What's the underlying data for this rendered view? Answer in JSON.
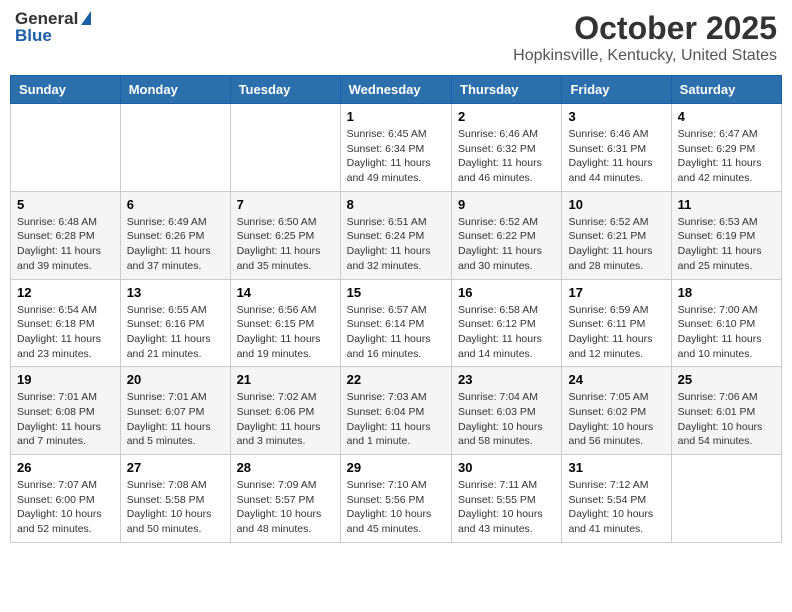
{
  "header": {
    "logo_general": "General",
    "logo_blue": "Blue",
    "month": "October 2025",
    "location": "Hopkinsville, Kentucky, United States"
  },
  "weekdays": [
    "Sunday",
    "Monday",
    "Tuesday",
    "Wednesday",
    "Thursday",
    "Friday",
    "Saturday"
  ],
  "weeks": [
    [
      {
        "day": "",
        "sunrise": "",
        "sunset": "",
        "daylight": ""
      },
      {
        "day": "",
        "sunrise": "",
        "sunset": "",
        "daylight": ""
      },
      {
        "day": "",
        "sunrise": "",
        "sunset": "",
        "daylight": ""
      },
      {
        "day": "1",
        "sunrise": "Sunrise: 6:45 AM",
        "sunset": "Sunset: 6:34 PM",
        "daylight": "Daylight: 11 hours and 49 minutes."
      },
      {
        "day": "2",
        "sunrise": "Sunrise: 6:46 AM",
        "sunset": "Sunset: 6:32 PM",
        "daylight": "Daylight: 11 hours and 46 minutes."
      },
      {
        "day": "3",
        "sunrise": "Sunrise: 6:46 AM",
        "sunset": "Sunset: 6:31 PM",
        "daylight": "Daylight: 11 hours and 44 minutes."
      },
      {
        "day": "4",
        "sunrise": "Sunrise: 6:47 AM",
        "sunset": "Sunset: 6:29 PM",
        "daylight": "Daylight: 11 hours and 42 minutes."
      }
    ],
    [
      {
        "day": "5",
        "sunrise": "Sunrise: 6:48 AM",
        "sunset": "Sunset: 6:28 PM",
        "daylight": "Daylight: 11 hours and 39 minutes."
      },
      {
        "day": "6",
        "sunrise": "Sunrise: 6:49 AM",
        "sunset": "Sunset: 6:26 PM",
        "daylight": "Daylight: 11 hours and 37 minutes."
      },
      {
        "day": "7",
        "sunrise": "Sunrise: 6:50 AM",
        "sunset": "Sunset: 6:25 PM",
        "daylight": "Daylight: 11 hours and 35 minutes."
      },
      {
        "day": "8",
        "sunrise": "Sunrise: 6:51 AM",
        "sunset": "Sunset: 6:24 PM",
        "daylight": "Daylight: 11 hours and 32 minutes."
      },
      {
        "day": "9",
        "sunrise": "Sunrise: 6:52 AM",
        "sunset": "Sunset: 6:22 PM",
        "daylight": "Daylight: 11 hours and 30 minutes."
      },
      {
        "day": "10",
        "sunrise": "Sunrise: 6:52 AM",
        "sunset": "Sunset: 6:21 PM",
        "daylight": "Daylight: 11 hours and 28 minutes."
      },
      {
        "day": "11",
        "sunrise": "Sunrise: 6:53 AM",
        "sunset": "Sunset: 6:19 PM",
        "daylight": "Daylight: 11 hours and 25 minutes."
      }
    ],
    [
      {
        "day": "12",
        "sunrise": "Sunrise: 6:54 AM",
        "sunset": "Sunset: 6:18 PM",
        "daylight": "Daylight: 11 hours and 23 minutes."
      },
      {
        "day": "13",
        "sunrise": "Sunrise: 6:55 AM",
        "sunset": "Sunset: 6:16 PM",
        "daylight": "Daylight: 11 hours and 21 minutes."
      },
      {
        "day": "14",
        "sunrise": "Sunrise: 6:56 AM",
        "sunset": "Sunset: 6:15 PM",
        "daylight": "Daylight: 11 hours and 19 minutes."
      },
      {
        "day": "15",
        "sunrise": "Sunrise: 6:57 AM",
        "sunset": "Sunset: 6:14 PM",
        "daylight": "Daylight: 11 hours and 16 minutes."
      },
      {
        "day": "16",
        "sunrise": "Sunrise: 6:58 AM",
        "sunset": "Sunset: 6:12 PM",
        "daylight": "Daylight: 11 hours and 14 minutes."
      },
      {
        "day": "17",
        "sunrise": "Sunrise: 6:59 AM",
        "sunset": "Sunset: 6:11 PM",
        "daylight": "Daylight: 11 hours and 12 minutes."
      },
      {
        "day": "18",
        "sunrise": "Sunrise: 7:00 AM",
        "sunset": "Sunset: 6:10 PM",
        "daylight": "Daylight: 11 hours and 10 minutes."
      }
    ],
    [
      {
        "day": "19",
        "sunrise": "Sunrise: 7:01 AM",
        "sunset": "Sunset: 6:08 PM",
        "daylight": "Daylight: 11 hours and 7 minutes."
      },
      {
        "day": "20",
        "sunrise": "Sunrise: 7:01 AM",
        "sunset": "Sunset: 6:07 PM",
        "daylight": "Daylight: 11 hours and 5 minutes."
      },
      {
        "day": "21",
        "sunrise": "Sunrise: 7:02 AM",
        "sunset": "Sunset: 6:06 PM",
        "daylight": "Daylight: 11 hours and 3 minutes."
      },
      {
        "day": "22",
        "sunrise": "Sunrise: 7:03 AM",
        "sunset": "Sunset: 6:04 PM",
        "daylight": "Daylight: 11 hours and 1 minute."
      },
      {
        "day": "23",
        "sunrise": "Sunrise: 7:04 AM",
        "sunset": "Sunset: 6:03 PM",
        "daylight": "Daylight: 10 hours and 58 minutes."
      },
      {
        "day": "24",
        "sunrise": "Sunrise: 7:05 AM",
        "sunset": "Sunset: 6:02 PM",
        "daylight": "Daylight: 10 hours and 56 minutes."
      },
      {
        "day": "25",
        "sunrise": "Sunrise: 7:06 AM",
        "sunset": "Sunset: 6:01 PM",
        "daylight": "Daylight: 10 hours and 54 minutes."
      }
    ],
    [
      {
        "day": "26",
        "sunrise": "Sunrise: 7:07 AM",
        "sunset": "Sunset: 6:00 PM",
        "daylight": "Daylight: 10 hours and 52 minutes."
      },
      {
        "day": "27",
        "sunrise": "Sunrise: 7:08 AM",
        "sunset": "Sunset: 5:58 PM",
        "daylight": "Daylight: 10 hours and 50 minutes."
      },
      {
        "day": "28",
        "sunrise": "Sunrise: 7:09 AM",
        "sunset": "Sunset: 5:57 PM",
        "daylight": "Daylight: 10 hours and 48 minutes."
      },
      {
        "day": "29",
        "sunrise": "Sunrise: 7:10 AM",
        "sunset": "Sunset: 5:56 PM",
        "daylight": "Daylight: 10 hours and 45 minutes."
      },
      {
        "day": "30",
        "sunrise": "Sunrise: 7:11 AM",
        "sunset": "Sunset: 5:55 PM",
        "daylight": "Daylight: 10 hours and 43 minutes."
      },
      {
        "day": "31",
        "sunrise": "Sunrise: 7:12 AM",
        "sunset": "Sunset: 5:54 PM",
        "daylight": "Daylight: 10 hours and 41 minutes."
      },
      {
        "day": "",
        "sunrise": "",
        "sunset": "",
        "daylight": ""
      }
    ]
  ]
}
